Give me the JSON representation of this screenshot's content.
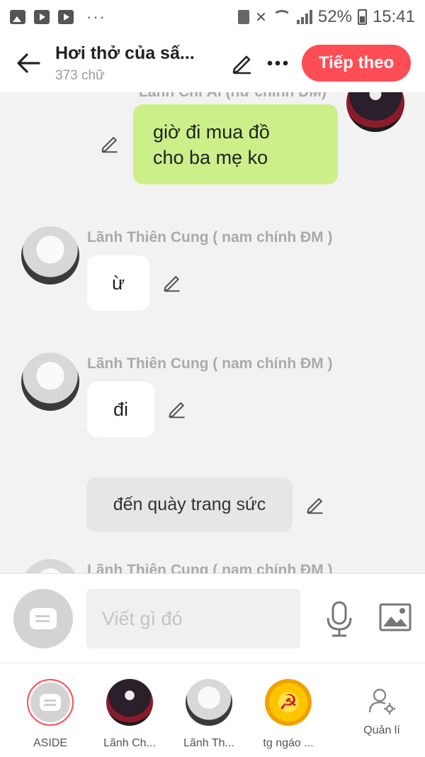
{
  "status_bar": {
    "battery": "52%",
    "time": "15:41",
    "more": "···"
  },
  "header": {
    "title": "Hơi thở của sấ...",
    "word_count": "373 chữ",
    "next_button": "Tiếp theo"
  },
  "chat": {
    "cut_off_top_sender": "Lãnh Chi Ái (nữ chính ĐM)",
    "messages": [
      {
        "side": "right",
        "text_line1": "giờ đi mua đồ",
        "text_line2": "cho ba mẹ ko"
      },
      {
        "side": "left",
        "sender": "Lãnh Thiên Cung ( nam chính ĐM )",
        "text": "ừ"
      },
      {
        "side": "left",
        "sender": "Lãnh Thiên Cung ( nam chính ĐM )",
        "text": "đi"
      },
      {
        "side": "aside",
        "text": "đến quày trang sức"
      },
      {
        "side": "left",
        "sender": "Lãnh Thiên Cung ( nam chính ĐM )"
      }
    ]
  },
  "input": {
    "placeholder": "Viết gì đó"
  },
  "characters": [
    {
      "label": "ASIDE"
    },
    {
      "label": "Lãnh Ch..."
    },
    {
      "label": "Lãnh Th..."
    },
    {
      "label": "tg ngáo ..."
    },
    {
      "label": "Quản lí"
    }
  ],
  "colors": {
    "accent": "#ff4d55",
    "my_bubble": "#cdef8a",
    "other_bubble": "#ffffff",
    "aside_bubble": "#e6e6e6",
    "background": "#f2f2f2"
  },
  "icons": [
    "image-icon",
    "video-icon",
    "youtube-icon",
    "back-arrow-icon",
    "pencil-icon",
    "more-icon",
    "microphone-icon",
    "gallery-icon",
    "manage-user-icon",
    "message-icon"
  ]
}
